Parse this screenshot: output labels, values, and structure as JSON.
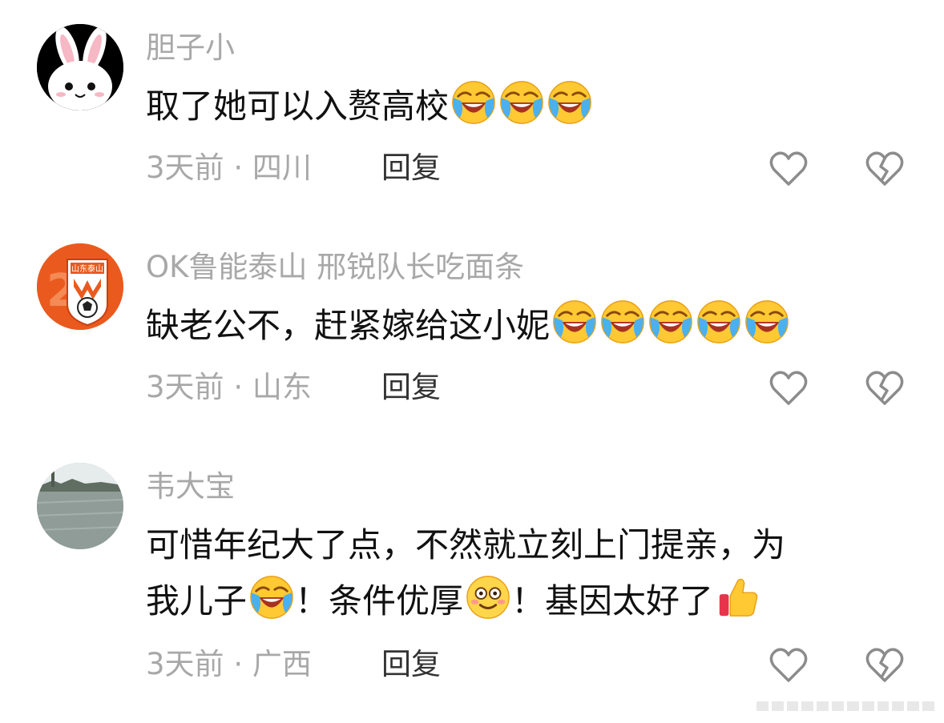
{
  "comments": [
    {
      "username": "胆子小",
      "text": "取了她可以入赘高校",
      "emojis": [
        "crying-laughing-emoji",
        "crying-laughing-emoji",
        "crying-laughing-emoji"
      ],
      "time": "3天前",
      "separator": "·",
      "location": "四川",
      "reply_label": "回复",
      "avatar": "bunny-avatar"
    },
    {
      "username": "OK鲁能泰山 邢锐队长吃面条",
      "text": "缺老公不，赶紧嫁给这小妮",
      "emojis": [
        "crying-laughing-emoji",
        "crying-laughing-emoji",
        "crying-laughing-emoji",
        "crying-laughing-emoji",
        "crying-laughing-emoji"
      ],
      "time": "3天前",
      "separator": "·",
      "location": "山东",
      "reply_label": "回复",
      "avatar": "shandong-taishan-badge",
      "avatar_badge_text": "山东泰山"
    },
    {
      "username": "韦大宝",
      "text_line1": "可惜年纪大了点，不然就立刻上门提亲，为",
      "text_part1": "我儿子",
      "text_part2": "！条件优厚",
      "text_part3": "！基因太好了",
      "time": "3天前",
      "separator": "·",
      "location": "广西",
      "reply_label": "回复",
      "avatar": "river-landscape-avatar"
    }
  ],
  "colors": {
    "username": "#a8a8a8",
    "text": "#111111",
    "meta": "#a8a8a8",
    "reply": "#333333",
    "icon": "#8c8c8c"
  }
}
